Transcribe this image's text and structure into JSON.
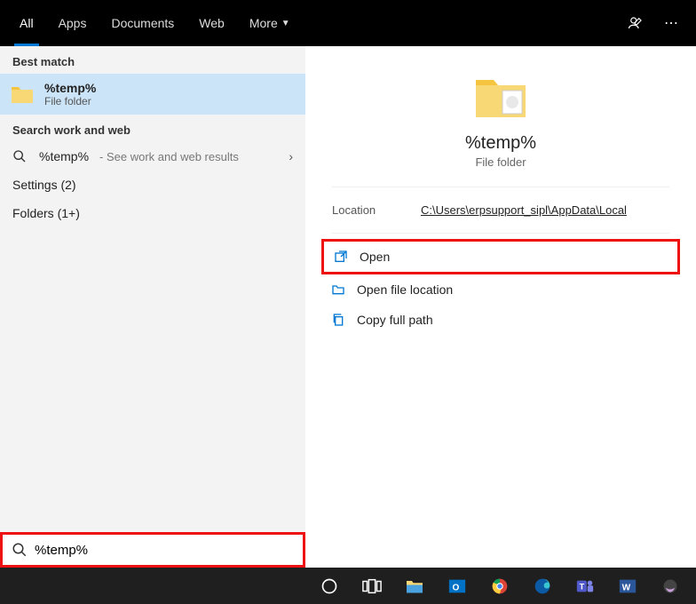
{
  "tabs": {
    "all": "All",
    "apps": "Apps",
    "documents": "Documents",
    "web": "Web",
    "more": "More"
  },
  "sections": {
    "best_match": "Best match",
    "search_work_web": "Search work and web",
    "settings": "Settings (2)",
    "folders": "Folders (1+)"
  },
  "best_match": {
    "title": "%temp%",
    "subtitle": "File folder"
  },
  "web_result": {
    "query": "%temp%",
    "hint": " - See work and web results"
  },
  "preview": {
    "title": "%temp%",
    "subtitle": "File folder",
    "location_label": "Location",
    "location_value": "C:\\Users\\erpsupport_sipl\\AppData\\Local"
  },
  "actions": {
    "open": "Open",
    "open_loc": "Open file location",
    "copy_path": "Copy full path"
  },
  "search": {
    "value": "%temp%"
  }
}
